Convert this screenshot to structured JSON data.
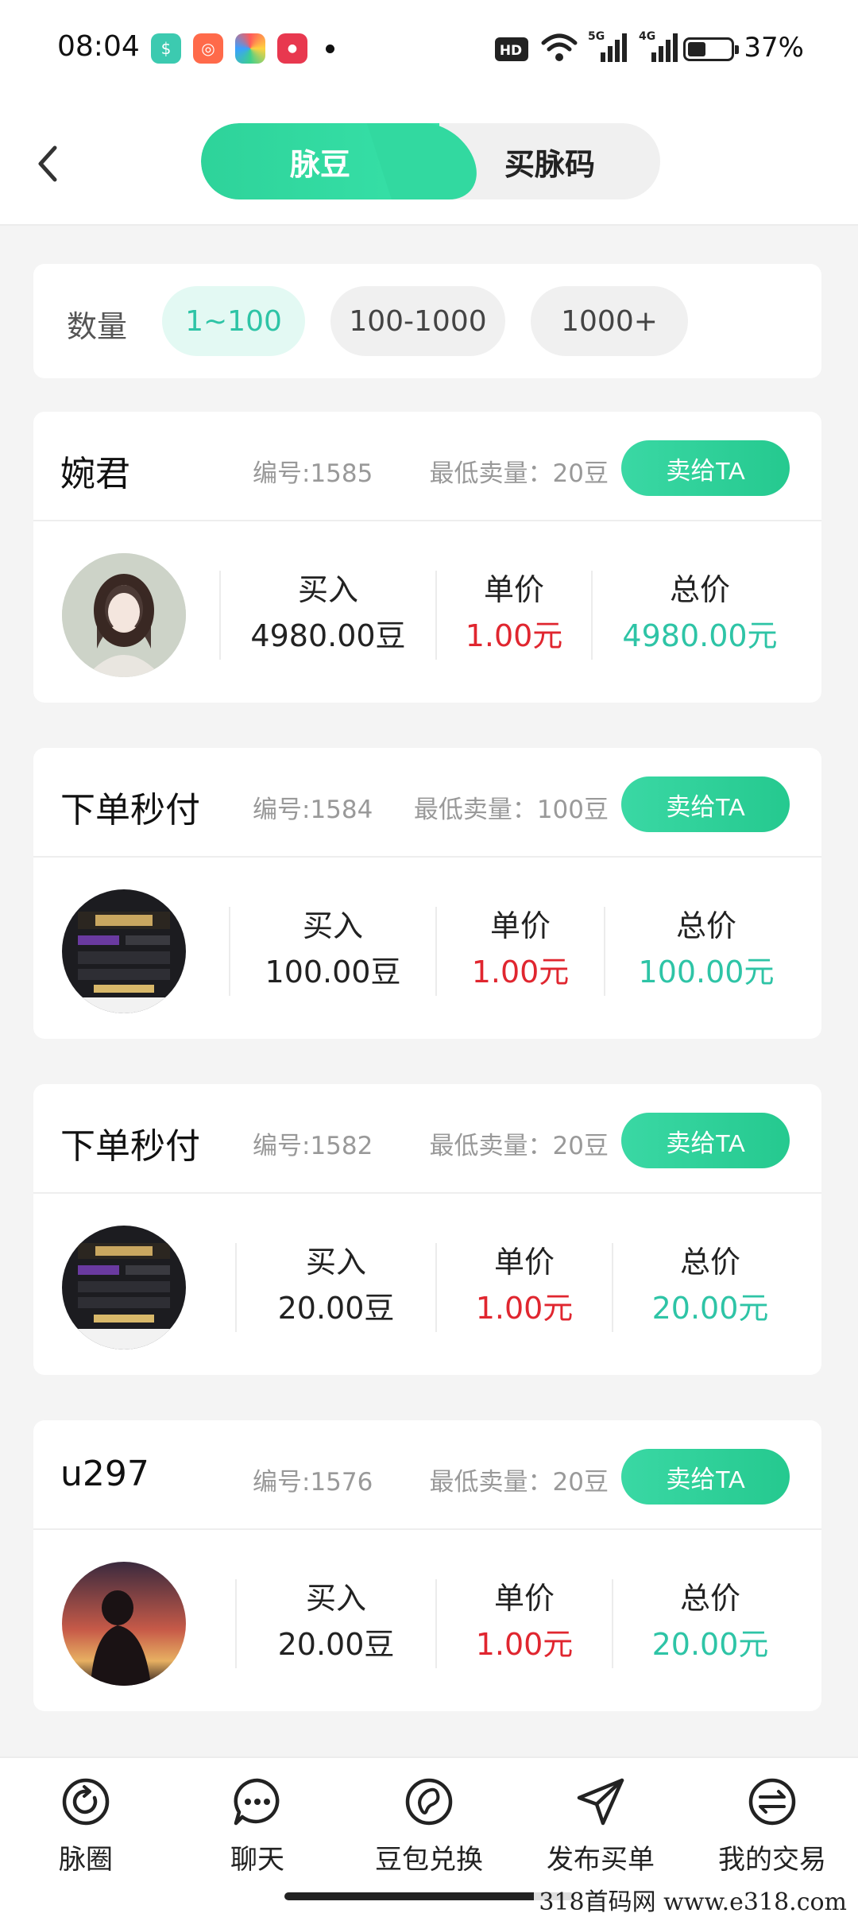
{
  "status_bar": {
    "time": "08:04",
    "battery_percent": "37%",
    "network_5g": "5G",
    "network_4g": "4G",
    "hd_badge": "HD"
  },
  "header": {
    "tabs": [
      {
        "label": "脉豆",
        "active": true
      },
      {
        "label": "买脉码",
        "active": false
      }
    ]
  },
  "filter": {
    "label": "数量",
    "options": [
      {
        "label": "1~100",
        "active": true
      },
      {
        "label": "100-1000",
        "active": false
      },
      {
        "label": "1000+",
        "active": false
      }
    ]
  },
  "column_labels": {
    "buy": "买入",
    "unit_price": "单价",
    "total": "总价"
  },
  "sell_button_label": "卖给TA",
  "listings": [
    {
      "seller": "婉君",
      "serial": "编号:1585",
      "min_sell": "最低卖量：20豆",
      "buy": "4980.00豆",
      "unit_price": "1.00元",
      "total": "4980.00元"
    },
    {
      "seller": "下单秒付",
      "serial": "编号:1584",
      "min_sell": "最低卖量：100豆",
      "buy": "100.00豆",
      "unit_price": "1.00元",
      "total": "100.00元"
    },
    {
      "seller": "下单秒付",
      "serial": "编号:1582",
      "min_sell": "最低卖量：20豆",
      "buy": "20.00豆",
      "unit_price": "1.00元",
      "total": "20.00元"
    },
    {
      "seller": "u297",
      "serial": "编号:1576",
      "min_sell": "最低卖量：20豆",
      "buy": "20.00豆",
      "unit_price": "1.00元",
      "total": "20.00元"
    }
  ],
  "bottom_nav": [
    {
      "label": "脉圈",
      "icon": "circle-refresh-icon"
    },
    {
      "label": "聊天",
      "icon": "chat-bubble-icon"
    },
    {
      "label": "豆包兑换",
      "icon": "bean-exchange-icon"
    },
    {
      "label": "发布买单",
      "icon": "paper-plane-icon"
    },
    {
      "label": "我的交易",
      "icon": "transfer-arrows-icon"
    }
  ],
  "watermark": "318首码网  www.e318.com",
  "colors": {
    "accent": "#2ed39a",
    "price_red": "#e0262f",
    "total_teal": "#2ec4a6"
  }
}
